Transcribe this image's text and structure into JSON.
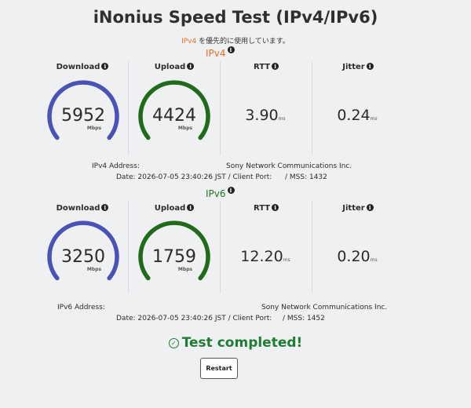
{
  "title": "iNonius Speed Test (IPv4/IPv6)",
  "preference": {
    "protocol": "IPv4",
    "text": " を優先的に使用しています。"
  },
  "colors": {
    "download": "#4a52b6",
    "upload": "#1f6b1a",
    "ipv4": "#e8702a",
    "ipv6": "#1f7a1f",
    "completed": "#1e7d32"
  },
  "ipv4": {
    "label": "IPv4",
    "headers": {
      "download": "Download",
      "upload": "Upload",
      "rtt": "RTT",
      "jitter": "Jitter"
    },
    "download": {
      "value": "5952",
      "unit": "Mbps"
    },
    "upload": {
      "value": "4424",
      "unit": "Mbps"
    },
    "rtt": {
      "value": "3.90",
      "unit": "ms"
    },
    "jitter": {
      "value": "0.24",
      "unit": "ms"
    },
    "address_label": "IPv4 Address:",
    "provider": "Sony Network Communications Inc.",
    "date_line": "Date: 2026-07-05 23:40:26 JST / Client Port:",
    "mss": "/ MSS: 1432"
  },
  "ipv6": {
    "label": "IPv6",
    "headers": {
      "download": "Download",
      "upload": "Upload",
      "rtt": "RTT",
      "jitter": "Jitter"
    },
    "download": {
      "value": "3250",
      "unit": "Mbps"
    },
    "upload": {
      "value": "1759",
      "unit": "Mbps"
    },
    "rtt": {
      "value": "12.20",
      "unit": "ms"
    },
    "jitter": {
      "value": "0.20",
      "unit": "ms"
    },
    "address_label": "IPv6 Address:",
    "provider": "Sony Network Communications Inc.",
    "date_line": "Date: 2026-07-05 23:40:26 JST / Client Port:",
    "mss": "/ MSS: 1452"
  },
  "status": "Test completed!",
  "restart_label": "Restart",
  "info_glyph": "i",
  "check_glyph": "✓"
}
